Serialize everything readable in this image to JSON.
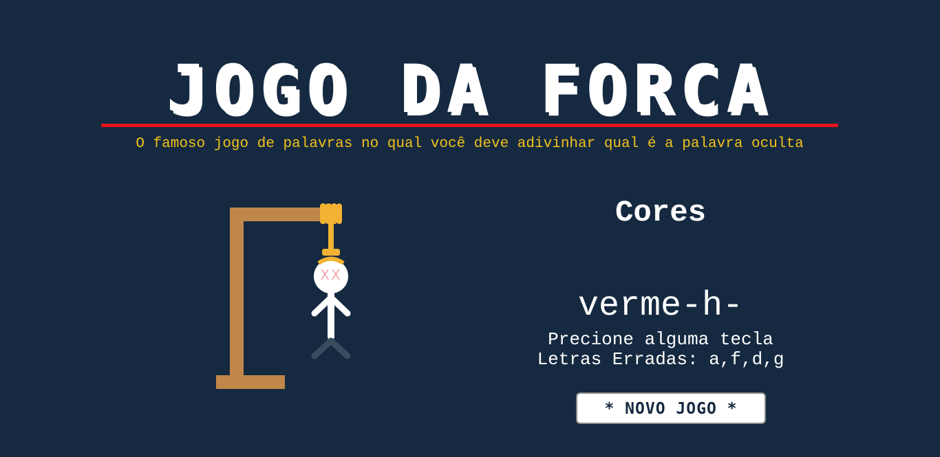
{
  "header": {
    "title": "JOGO DA FORCA",
    "subtitle": "O famoso jogo de palavras no qual você deve adivinhar qual é a palavra oculta"
  },
  "game": {
    "category": "Cores",
    "masked_word": "verme-h-",
    "prompt": "Precione alguma tecla",
    "wrong_letters_label": "Letras Erradas:",
    "wrong_letters": "a,f,d,g",
    "new_game_label": "* NOVO JOGO *",
    "eyes": "XX"
  },
  "colors": {
    "background": "#152940",
    "accent_rule": "#e3141b",
    "subtitle": "#f3c21d",
    "gallows_wood": "#c0874a",
    "rope": "#f2b233",
    "body": "#ffffff",
    "legs_hidden": "#3a4b5e",
    "eyes": "#f4a8b0"
  }
}
